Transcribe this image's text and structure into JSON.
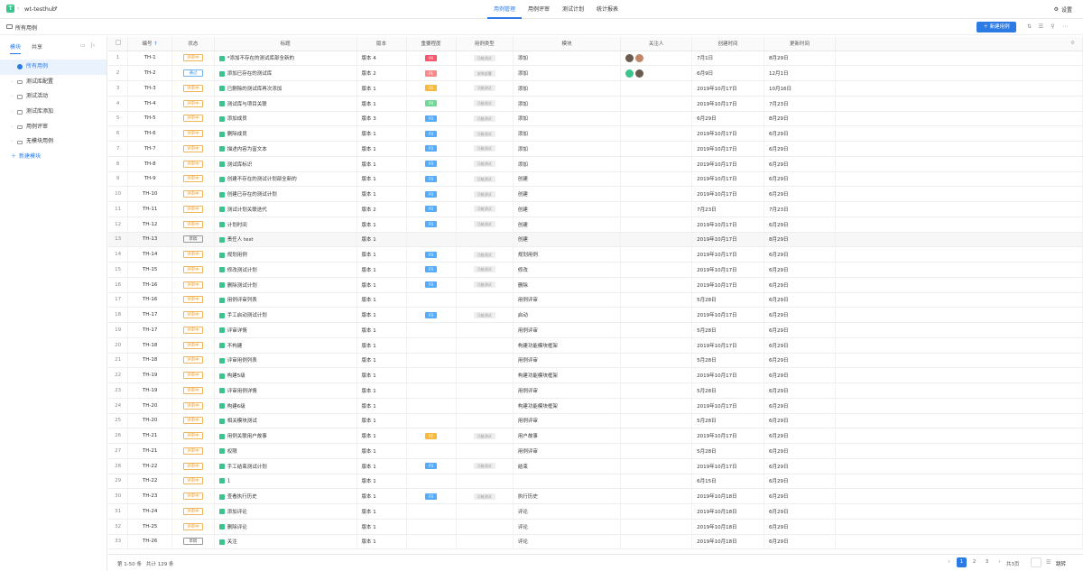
{
  "header": {
    "logo": "T",
    "project": "wt-testhub",
    "tabs": [
      "用例管理",
      "用例评审",
      "测试计划",
      "统计报表"
    ],
    "active_tab": 0,
    "settings": "设置"
  },
  "toolbar": {
    "breadcrumb": "所有用例",
    "new_button": "新建用例"
  },
  "sidebar": {
    "tabs": [
      "模块",
      "共享"
    ],
    "items": [
      {
        "label": "所有用例",
        "type": "all",
        "active": true
      },
      {
        "label": "测试库配置",
        "type": "folder"
      },
      {
        "label": "测试活动",
        "type": "folder"
      },
      {
        "label": "测试库添加",
        "type": "folder"
      },
      {
        "label": "用例评审",
        "type": "folder"
      },
      {
        "label": "无模块用例",
        "type": "folder"
      },
      {
        "label": "新建模块",
        "type": "add"
      }
    ]
  },
  "table": {
    "headers": [
      "编号",
      "状态",
      "标题",
      "版本",
      "重要程度",
      "用例类型",
      "模块",
      "关注人",
      "创建时间",
      "更新时间"
    ],
    "rows": [
      {
        "n": "1",
        "id": "TH-1",
        "status": "评审中",
        "title": "*添加不存在的测试库部全新的",
        "ver": "版本 4",
        "prio": "P0",
        "ptype": "功能测试",
        "module": "添加",
        "followers": [
          "a1",
          "a2"
        ],
        "created": "7月1日",
        "updated": "8月29日"
      },
      {
        "n": "2",
        "id": "TH-2",
        "status": "通过",
        "title": "添加已存在的测试库",
        "ver": "版本 2",
        "prio": "P1",
        "ptype": "安装部署",
        "module": "添加",
        "followers": [
          "a3",
          "a1"
        ],
        "created": "6月9日",
        "updated": "12月1日"
      },
      {
        "n": "3",
        "id": "TH-3",
        "status": "评审中",
        "title": "已删除的测试库再次添加",
        "ver": "版本 1",
        "prio": "P2",
        "ptype": "功能测试",
        "module": "添加",
        "followers": [],
        "created": "2019年10月17日",
        "updated": "10月16日"
      },
      {
        "n": "4",
        "id": "TH-4",
        "status": "评审中",
        "title": "测试库与项目关联",
        "ver": "版本 1",
        "prio": "P4",
        "ptype": "功能测试",
        "module": "添加",
        "followers": [],
        "created": "2019年10月17日",
        "updated": "7月23日"
      },
      {
        "n": "5",
        "id": "TH-5",
        "status": "评审中",
        "title": "添加成员",
        "ver": "版本 3",
        "prio": "P3",
        "ptype": "功能测试",
        "module": "添加",
        "followers": [],
        "created": "6月29日",
        "updated": "8月29日"
      },
      {
        "n": "6",
        "id": "TH-6",
        "status": "评审中",
        "title": "删除成员",
        "ver": "版本 1",
        "prio": "P3",
        "ptype": "功能测试",
        "module": "添加",
        "followers": [],
        "created": "2019年10月17日",
        "updated": "6月29日"
      },
      {
        "n": "7",
        "id": "TH-7",
        "status": "评审中",
        "title": "描述内容为富文本",
        "ver": "版本 1",
        "prio": "P3",
        "ptype": "功能测试",
        "module": "添加",
        "followers": [],
        "created": "2019年10月17日",
        "updated": "6月29日"
      },
      {
        "n": "8",
        "id": "TH-8",
        "status": "评审中",
        "title": "测试库标识",
        "ver": "版本 1",
        "prio": "P3",
        "ptype": "功能测试",
        "module": "添加",
        "followers": [],
        "created": "2019年10月17日",
        "updated": "6月29日"
      },
      {
        "n": "9",
        "id": "TH-9",
        "status": "评审中",
        "title": "创建不存在的测试计划部全新的",
        "ver": "版本 1",
        "prio": "P3",
        "ptype": "功能测试",
        "module": "创建",
        "followers": [],
        "created": "2019年10月17日",
        "updated": "6月29日"
      },
      {
        "n": "10",
        "id": "TH-10",
        "status": "评审中",
        "title": "创建已存在的测试计划",
        "ver": "版本 1",
        "prio": "P3",
        "ptype": "功能测试",
        "module": "创建",
        "followers": [],
        "created": "2019年10月17日",
        "updated": "6月29日"
      },
      {
        "n": "11",
        "id": "TH-11",
        "status": "评审中",
        "title": "测试计划关联迭代",
        "ver": "版本 2",
        "prio": "P3",
        "ptype": "功能测试",
        "module": "创建",
        "followers": [],
        "created": "7月23日",
        "updated": "7月23日"
      },
      {
        "n": "12",
        "id": "TH-12",
        "status": "评审中",
        "title": "计划时间",
        "ver": "版本 1",
        "prio": "P3",
        "ptype": "功能测试",
        "module": "创建",
        "followers": [],
        "created": "2019年10月17日",
        "updated": "6月29日"
      },
      {
        "n": "13",
        "id": "TH-13",
        "status": "草稿",
        "title": "责任人 test",
        "ver": "版本 1",
        "prio": "",
        "ptype": "",
        "module": "创建",
        "followers": [],
        "created": "2019年10月17日",
        "updated": "8月29日",
        "hl": true
      },
      {
        "n": "14",
        "id": "TH-14",
        "status": "评审中",
        "title": "规划用例",
        "ver": "版本 1",
        "prio": "P3",
        "ptype": "功能测试",
        "module": "规划用例",
        "followers": [],
        "created": "2019年10月17日",
        "updated": "6月29日"
      },
      {
        "n": "15",
        "id": "TH-15",
        "status": "评审中",
        "title": "修改测试计划",
        "ver": "版本 1",
        "prio": "P3",
        "ptype": "功能测试",
        "module": "修改",
        "followers": [],
        "created": "2019年10月17日",
        "updated": "6月29日"
      },
      {
        "n": "16",
        "id": "TH-16",
        "status": "评审中",
        "title": "删除测试计划",
        "ver": "版本 1",
        "prio": "P3",
        "ptype": "功能测试",
        "module": "删除",
        "followers": [],
        "created": "2019年10月17日",
        "updated": "6月29日"
      },
      {
        "n": "17",
        "id": "TH-16",
        "status": "评审中",
        "title": "用例评审列表",
        "ver": "版本 1",
        "prio": "",
        "ptype": "",
        "module": "用例评审",
        "followers": [],
        "created": "5月28日",
        "updated": "6月29日"
      },
      {
        "n": "18",
        "id": "TH-17",
        "status": "评审中",
        "title": "手工启动测试计划",
        "ver": "版本 1",
        "prio": "P3",
        "ptype": "功能测试",
        "module": "启动",
        "followers": [],
        "created": "2019年10月17日",
        "updated": "6月29日"
      },
      {
        "n": "19",
        "id": "TH-17",
        "status": "评审中",
        "title": "评审详情",
        "ver": "版本 1",
        "prio": "",
        "ptype": "",
        "module": "用例评审",
        "followers": [],
        "created": "5月28日",
        "updated": "6月29日"
      },
      {
        "n": "20",
        "id": "TH-18",
        "status": "评审中",
        "title": "不构建",
        "ver": "版本 1",
        "prio": "",
        "ptype": "",
        "module": "构建功能模块框架",
        "followers": [],
        "created": "2019年10月17日",
        "updated": "6月29日"
      },
      {
        "n": "21",
        "id": "TH-18",
        "status": "评审中",
        "title": "评审用例列表",
        "ver": "版本 1",
        "prio": "",
        "ptype": "",
        "module": "用例评审",
        "followers": [],
        "created": "5月28日",
        "updated": "6月29日"
      },
      {
        "n": "22",
        "id": "TH-19",
        "status": "评审中",
        "title": "构建5级",
        "ver": "版本 1",
        "prio": "",
        "ptype": "",
        "module": "构建功能模块框架",
        "followers": [],
        "created": "2019年10月17日",
        "updated": "6月29日"
      },
      {
        "n": "23",
        "id": "TH-19",
        "status": "评审中",
        "title": "评审用例详情",
        "ver": "版本 1",
        "prio": "",
        "ptype": "",
        "module": "用例评审",
        "followers": [],
        "created": "5月28日",
        "updated": "6月29日"
      },
      {
        "n": "24",
        "id": "TH-20",
        "status": "评审中",
        "title": "构建6级",
        "ver": "版本 1",
        "prio": "",
        "ptype": "",
        "module": "构建功能模块框架",
        "followers": [],
        "created": "2019年10月17日",
        "updated": "6月29日"
      },
      {
        "n": "25",
        "id": "TH-20",
        "status": "评审中",
        "title": "相关模块测试",
        "ver": "版本 1",
        "prio": "",
        "ptype": "",
        "module": "用例评审",
        "followers": [],
        "created": "5月28日",
        "updated": "6月29日"
      },
      {
        "n": "26",
        "id": "TH-21",
        "status": "评审中",
        "title": "用例关联用户故事",
        "ver": "版本 1",
        "prio": "P2",
        "ptype": "功能测试",
        "module": "用户故事",
        "followers": [],
        "created": "2019年10月17日",
        "updated": "6月29日"
      },
      {
        "n": "27",
        "id": "TH-21",
        "status": "评审中",
        "title": "权限",
        "ver": "版本 1",
        "prio": "",
        "ptype": "",
        "module": "用例评审",
        "followers": [],
        "created": "5月28日",
        "updated": "6月29日"
      },
      {
        "n": "28",
        "id": "TH-22",
        "status": "评审中",
        "title": "手工结束测试计划",
        "ver": "版本 1",
        "prio": "P3",
        "ptype": "功能测试",
        "module": "结束",
        "followers": [],
        "created": "2019年10月17日",
        "updated": "6月29日"
      },
      {
        "n": "29",
        "id": "TH-22",
        "status": "评审中",
        "title": "1",
        "ver": "版本 1",
        "prio": "",
        "ptype": "",
        "module": "",
        "followers": [],
        "created": "6月15日",
        "updated": "6月29日"
      },
      {
        "n": "30",
        "id": "TH-23",
        "status": "评审中",
        "title": "查看执行历史",
        "ver": "版本 1",
        "prio": "P3",
        "ptype": "功能测试",
        "module": "执行历史",
        "followers": [],
        "created": "2019年10月18日",
        "updated": "6月29日"
      },
      {
        "n": "31",
        "id": "TH-24",
        "status": "评审中",
        "title": "添加评论",
        "ver": "版本 1",
        "prio": "",
        "ptype": "",
        "module": "评论",
        "followers": [],
        "created": "2019年10月18日",
        "updated": "6月29日"
      },
      {
        "n": "32",
        "id": "TH-25",
        "status": "评审中",
        "title": "删除评论",
        "ver": "版本 1",
        "prio": "",
        "ptype": "",
        "module": "评论",
        "followers": [],
        "created": "2019年10月18日",
        "updated": "6月29日"
      },
      {
        "n": "33",
        "id": "TH-26",
        "status": "草稿",
        "title": "关注",
        "ver": "版本 1",
        "prio": "",
        "ptype": "",
        "module": "评论",
        "followers": [],
        "created": "2019年10月18日",
        "updated": "6月29日"
      }
    ]
  },
  "prio_colors": {
    "P0": "#f5576c",
    "P1": "#fa8888",
    "P2": "#f7ba3f",
    "P3": "#56abfb",
    "P4": "#73d897"
  },
  "footer": {
    "range": "第 1-50 条",
    "total": "共计 129 条",
    "pages": [
      "1",
      "2",
      "3"
    ],
    "current_page": "1",
    "page_count": "共3页",
    "go": "跳转"
  }
}
